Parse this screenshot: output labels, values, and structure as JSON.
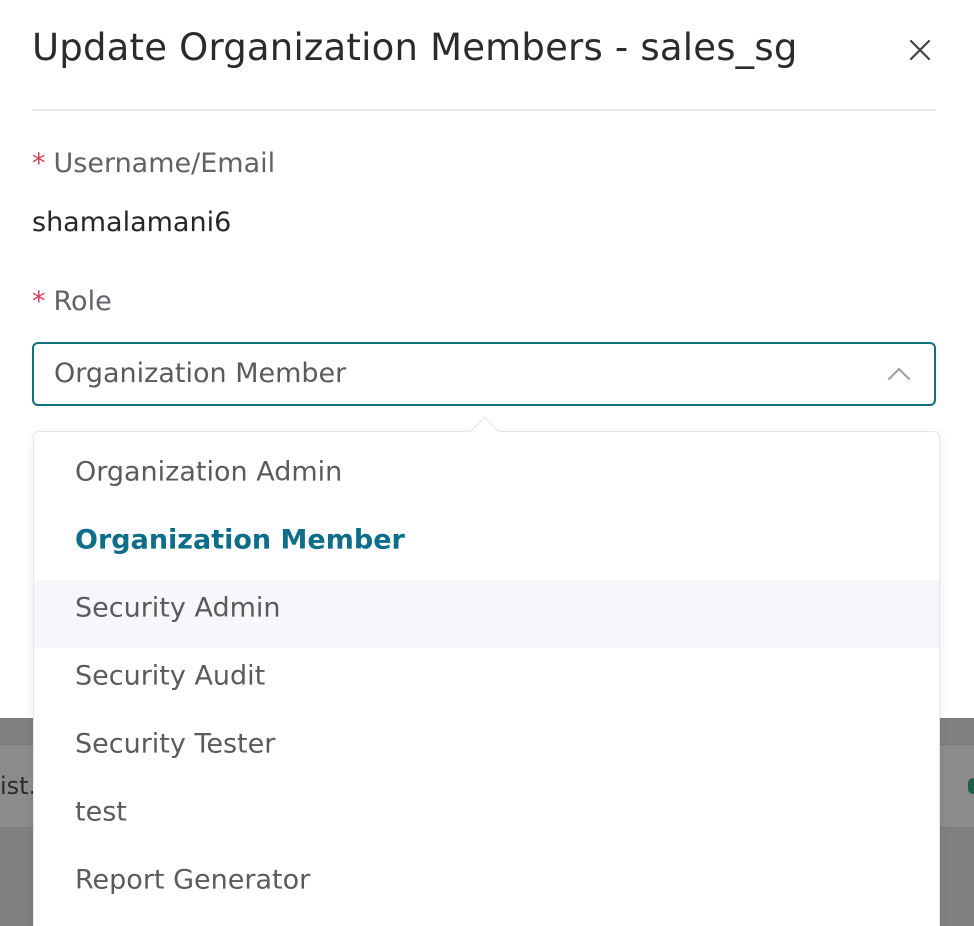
{
  "modal": {
    "title": "Update Organization Members - sales_sg",
    "username_label": "Username/Email",
    "username_value": "shamalamani6",
    "role_label": "Role",
    "required_marker": "*",
    "role_selected": "Organization Member"
  },
  "dropdown": {
    "options": [
      {
        "label": "Organization Admin"
      },
      {
        "label": "Organization Member"
      },
      {
        "label": "Security Admin"
      },
      {
        "label": "Security Audit"
      },
      {
        "label": "Security Tester"
      },
      {
        "label": "test"
      },
      {
        "label": "Report Generator"
      }
    ]
  },
  "background": {
    "fragment_text": "ist."
  },
  "colors": {
    "accent": "#10707f",
    "selected_option": "#0d6e8a",
    "required": "#d23f57",
    "hover_bg": "#f5f7fa"
  },
  "icons": {
    "close": "close-icon",
    "chevron": "chevron-up-icon"
  }
}
